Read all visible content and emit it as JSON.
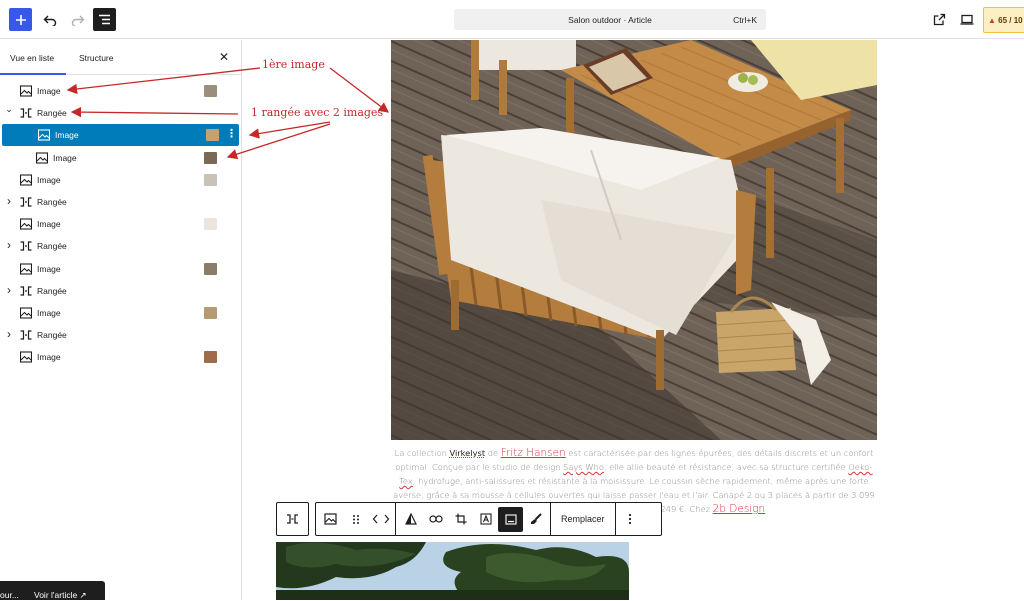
{
  "toolbar": {
    "add_icon": "plus-icon",
    "undo_icon": "undo-icon",
    "redo_icon": "redo-icon",
    "list_view_icon": "list-view-icon",
    "command_title": "Salon outdoor · Article",
    "command_shortcut": "Ctrl+K",
    "view_icon": "external-link-icon",
    "preview_icon": "desktop-icon",
    "score_label": "65 / 10"
  },
  "sidebar": {
    "tabs": [
      "Vue en liste",
      "Structure"
    ],
    "close_icon": "close-icon",
    "items": [
      {
        "label": "Image",
        "type": "image"
      },
      {
        "label": "Rangée",
        "type": "row",
        "expanded": true
      },
      {
        "label": "Image",
        "type": "image",
        "selected": true
      },
      {
        "label": "Image",
        "type": "image"
      },
      {
        "label": "Image",
        "type": "image"
      },
      {
        "label": "Rangée",
        "type": "row",
        "expanded": false
      },
      {
        "label": "Image",
        "type": "image"
      },
      {
        "label": "Rangée",
        "type": "row",
        "expanded": false
      },
      {
        "label": "Image",
        "type": "image"
      },
      {
        "label": "Rangée",
        "type": "row",
        "expanded": false
      },
      {
        "label": "Image",
        "type": "image"
      },
      {
        "label": "Rangée",
        "type": "row",
        "expanded": false
      },
      {
        "label": "Image",
        "type": "image"
      }
    ]
  },
  "annotations": {
    "first_image": "1ère image",
    "row_two_images": "1 rangée avec 2 images"
  },
  "caption": {
    "t1": "La collection ",
    "brand": "Virkelyst",
    "t2": " de ",
    "link1": "Fritz Hansen",
    "t3": " est caractérisée par des lignes épurées, des détails discrets et un confort optimal. Conçue par le studio de design ",
    "studio": "Says Who",
    "t4": ", elle allie beauté et résistance, avec sa structure certifiée ",
    "cert": "Oeko-Tex",
    "t5": ", hydrofuge, anti-salissures et résistante à la moisissure. Le coussin sèche rapidement, même après une forte averse, grâce à sa mousse à cellules ouvertes qui laisse passer l'eau et l'air. Canapé 2 ou 3 places à partir de 3 099 €. Table basse L 113xP68xH38cm à 1 249 €. Chez ",
    "link2": "2b Design"
  },
  "block_toolbar": {
    "parent_icon": "row-icon",
    "image_icon": "image-icon",
    "drag_icon": "drag-handle-icon",
    "move_icon": "move-arrows-icon",
    "triangle_icon": "duotone-icon",
    "link_icon": "link-icon",
    "crop_icon": "crop-icon",
    "text_icon": "text-over-image-icon",
    "caption_icon": "caption-icon",
    "style_icon": "paint-brush-icon",
    "replace_label": "Remplacer",
    "more_icon": "more-vertical-icon"
  },
  "snackbar": {
    "text": "our...",
    "link": "Voir l'article ↗"
  },
  "colors": {
    "accent": "#3858e9",
    "selected": "#007cba",
    "annotation": "#c62828",
    "link": "#d63638"
  }
}
